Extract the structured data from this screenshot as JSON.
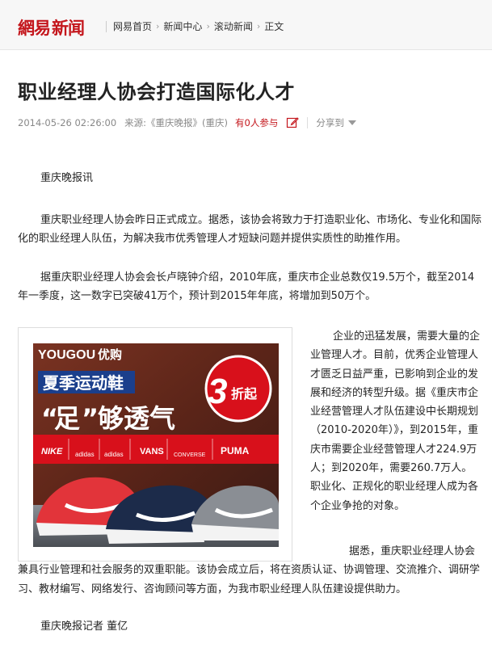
{
  "header": {
    "logo_part1": "網易",
    "logo_part2": "新闻",
    "breadcrumbs": [
      "网易首页",
      "新闻中心",
      "滚动新闻",
      "正文"
    ]
  },
  "article": {
    "title": "职业经理人协会打造国际化人才",
    "datetime": "2014-05-26 02:26:00",
    "source": "来源:《重庆晚报》(重庆)",
    "participants": "有0人参与",
    "share_label": "分享到",
    "p1": "重庆晚报讯",
    "p2": "重庆职业经理人协会昨日正式成立。据悉，该协会将致力于打造职业化、市场化、专业化和国际化的职业经理人队伍，为解决我市优秀管理人才短缺问题并提供实质性的助推作用。",
    "p3": "据重庆职业经理人协会会长卢晓钟介绍，2010年底，重庆市企业总数仅19.5万个，截至2014年一季度，这一数字已突破41万个，预计到2015年年底，将增加到50万个。",
    "p4": "企业的迅猛发展，需要大量的企业管理人才。目前，优秀企业管理人才匮乏日益严重，已影响到企业的发展和经济的转型升级。据《重庆市企业经营管理人才队伍建设中长期规划（2010-2020年）》，到2015年，重庆市需要企业经营管理人才224.9万人；到2020年，需要260.7万人。职业化、正规化的职业经理人成为各个企业争抢的对象。",
    "p5": "据悉，重庆职业经理人协会兼具行业管理和社会服务的双重职能。该协会成立后，将在资质认证、协调管理、交流推介、调研学习、教材编写、网络发行、咨询顾问等方面，为我市职业经理人队伍建设提供助力。",
    "byline": "重庆晚报记者  董亿"
  },
  "ad": {
    "brand": "YOUGOU",
    "brand_cn": "优购",
    "headline": "夏季运动鞋",
    "slogan_quote_open": "“",
    "slogan_key": "足",
    "slogan_quote_close": "”",
    "slogan_rest": "够透气",
    "discount_num": "3",
    "discount_text": "折起",
    "logos": [
      "NIKE",
      "adidas",
      "adidas",
      "VANS",
      "CONVERSE",
      "PUMA"
    ]
  }
}
